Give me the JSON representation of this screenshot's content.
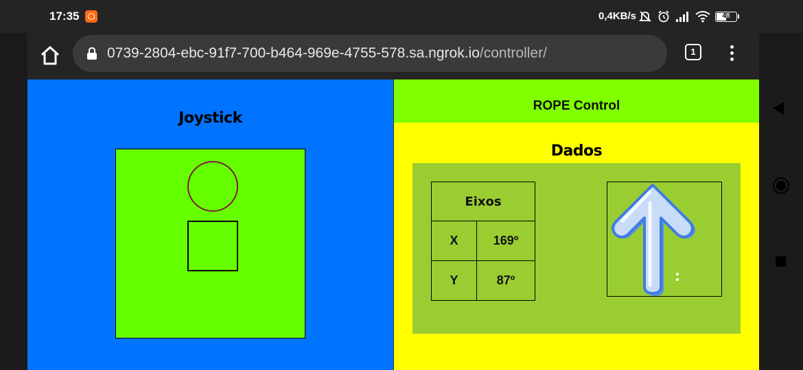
{
  "status_bar": {
    "time": "17:35",
    "net_speed": "0,4KB/s",
    "battery": "48",
    "icons": [
      "app-notification-icon",
      "mute-icon",
      "alarm-icon",
      "signal-icon",
      "wifi-icon",
      "battery-icon"
    ]
  },
  "browser": {
    "url_host": "0739-2804-ebc-91f7-700-b464-969e-4755-578.sa.ngrok.io",
    "url_path": "/controller/",
    "tab_count": "1"
  },
  "joystick": {
    "title": "Joystick"
  },
  "control": {
    "header": "ROPE Control",
    "data_title": "Dados",
    "table": {
      "header": "Eixos",
      "rows": [
        {
          "axis": "X",
          "value": "169º"
        },
        {
          "axis": "Y",
          "value": "87º"
        }
      ]
    },
    "direction_icon": "arrow-up-icon"
  },
  "colors": {
    "left_panel": "#0073ff",
    "joystick_area": "#66ff00",
    "header_green": "#7fff00",
    "right_panel": "#ffff00",
    "data_box": "#9acd32"
  }
}
